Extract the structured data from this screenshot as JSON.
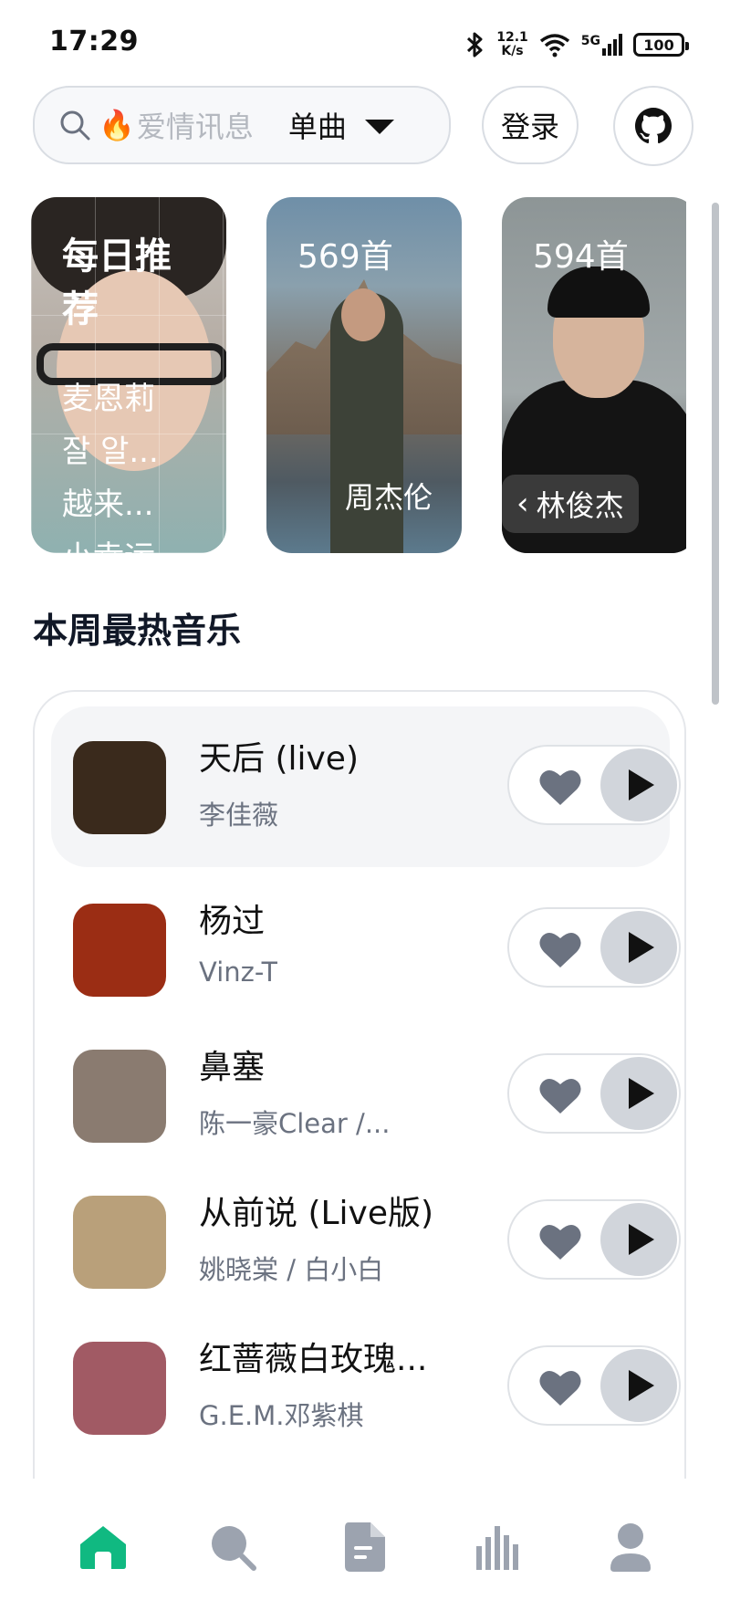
{
  "status_bar": {
    "time": "17:29",
    "speed_value": "12.1",
    "speed_unit": "K/s",
    "network": "5G",
    "battery": "100"
  },
  "header": {
    "search_placeholder": "爱情讯息",
    "search_type": "单曲",
    "login_label": "登录",
    "github_icon": "github-icon"
  },
  "carousel": {
    "daily": {
      "title": "每日推荐",
      "lines": [
        "麦恩莉",
        "잘 알...",
        "越来...",
        "小幸运"
      ]
    },
    "cards": [
      {
        "count": "569首",
        "name": "周杰伦"
      },
      {
        "count": "594首",
        "name": "林俊杰"
      }
    ]
  },
  "section": {
    "title": "本周最热音乐"
  },
  "songs": [
    {
      "title": "天后 (live)",
      "artist": "李佳薇",
      "cover_color": "#3a2a1c"
    },
    {
      "title": "杨过",
      "artist": "Vinz-T",
      "cover_color": "#9b2d14"
    },
    {
      "title": "鼻塞",
      "artist": "陈一豪Clear /...",
      "cover_color": "#8a7b70"
    },
    {
      "title": "从前说 (Live版)",
      "artist": "姚晓棠 / 白小白",
      "cover_color": "#b9a07a"
    },
    {
      "title": "红蔷薇白玫瑰...",
      "artist": "G.E.M.邓紫棋",
      "cover_color": "#a15a64"
    }
  ],
  "colors": {
    "accent": "#10b981",
    "nav_inactive": "#9ca3af",
    "active_row": "#f4f5f7"
  },
  "bottom_nav": [
    "home-icon",
    "search-icon",
    "document-icon",
    "chart-icon",
    "user-icon"
  ]
}
